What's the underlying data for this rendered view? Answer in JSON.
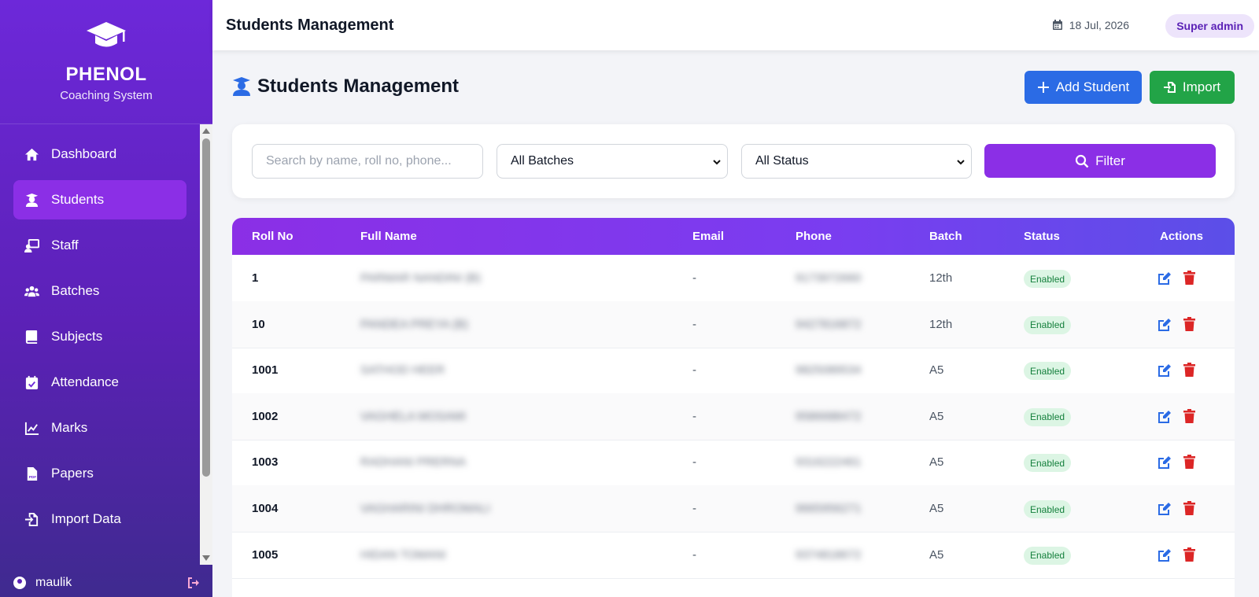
{
  "brand": {
    "name": "PHENOL",
    "subtitle": "Coaching System"
  },
  "sidebar": {
    "items": [
      {
        "label": "Dashboard",
        "icon": "home-icon",
        "active": false
      },
      {
        "label": "Students",
        "icon": "student-icon",
        "active": true
      },
      {
        "label": "Staff",
        "icon": "staff-icon",
        "active": false
      },
      {
        "label": "Batches",
        "icon": "users-icon",
        "active": false
      },
      {
        "label": "Subjects",
        "icon": "book-icon",
        "active": false
      },
      {
        "label": "Attendance",
        "icon": "calendar-check-icon",
        "active": false
      },
      {
        "label": "Marks",
        "icon": "chart-line-icon",
        "active": false
      },
      {
        "label": "Papers",
        "icon": "pdf-file-icon",
        "active": false
      },
      {
        "label": "Import Data",
        "icon": "import-icon",
        "active": false
      }
    ],
    "user": {
      "name": "maulik"
    }
  },
  "topbar": {
    "title": "Students Management",
    "date": "18 Jul, 2026",
    "role": "Super admin"
  },
  "page": {
    "heading": "Students Management",
    "add_button": "Add Student",
    "import_button": "Import"
  },
  "filters": {
    "search_placeholder": "Search by name, roll no, phone...",
    "batch_selected": "All Batches",
    "status_selected": "All Status",
    "filter_button": "Filter"
  },
  "table": {
    "headers": {
      "roll": "Roll No",
      "name": "Full Name",
      "email": "Email",
      "phone": "Phone",
      "batch": "Batch",
      "status": "Status",
      "actions": "Actions"
    },
    "rows": [
      {
        "roll": "1",
        "name": "PARMAR NANDINI (B)",
        "email": "-",
        "phone": "9173972660",
        "batch": "12th",
        "status": "Enabled"
      },
      {
        "roll": "10",
        "name": "PANDEA PREYA (B)",
        "email": "-",
        "phone": "9427816872",
        "batch": "12th",
        "status": "Enabled"
      },
      {
        "roll": "1001",
        "name": "SATHOD HEER",
        "email": "-",
        "phone": "9825089534",
        "batch": "A5",
        "status": "Enabled"
      },
      {
        "roll": "1002",
        "name": "VAGHELA MOSAMI",
        "email": "-",
        "phone": "9586688472",
        "batch": "A5",
        "status": "Enabled"
      },
      {
        "roll": "1003",
        "name": "RADHANI PRERNA",
        "email": "-",
        "phone": "9316222461",
        "batch": "A5",
        "status": "Enabled"
      },
      {
        "roll": "1004",
        "name": "VAGHARINI DHROMALI",
        "email": "-",
        "phone": "9665956271",
        "batch": "A5",
        "status": "Enabled"
      },
      {
        "roll": "1005",
        "name": "HIDAN TOMANI",
        "email": "-",
        "phone": "9374818672",
        "batch": "A5",
        "status": "Enabled"
      }
    ]
  },
  "colors": {
    "primary_purple": "#8b2fe6",
    "blue": "#2b6be5",
    "green": "#22a447",
    "danger": "#dc2626"
  }
}
